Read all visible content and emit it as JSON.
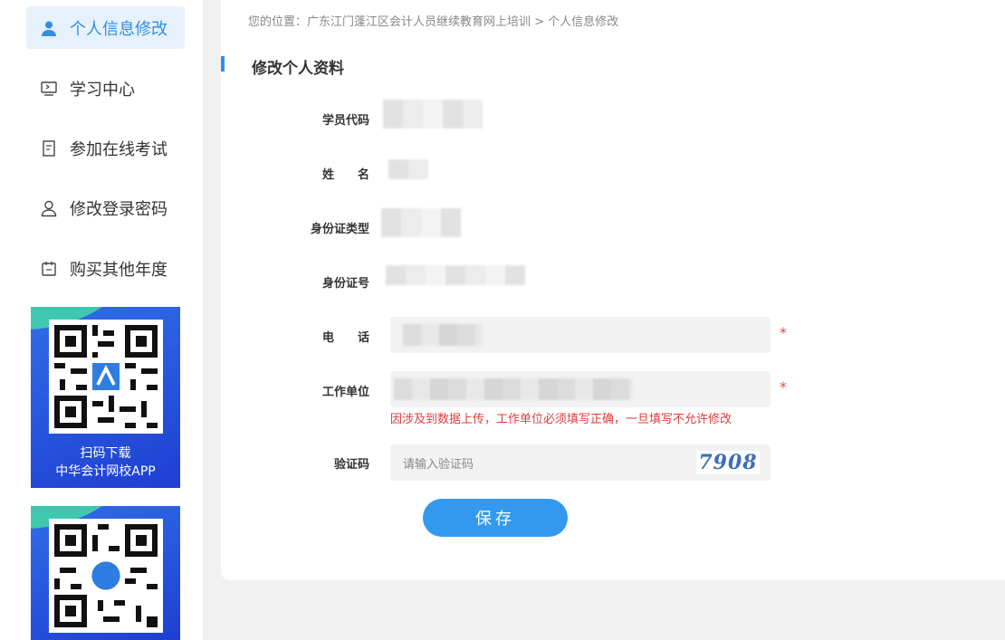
{
  "sidebar": {
    "items": [
      {
        "label": "个人信息修改",
        "icon": "user-icon",
        "active": true
      },
      {
        "label": "学习中心",
        "icon": "monitor-icon",
        "active": false
      },
      {
        "label": "参加在线考试",
        "icon": "exam-doc-icon",
        "active": false
      },
      {
        "label": "修改登录密码",
        "icon": "user-icon",
        "active": false
      },
      {
        "label": "购买其他年度",
        "icon": "calendar-icon",
        "active": false
      }
    ],
    "promos": [
      {
        "caption_line1": "扫码下载",
        "caption_line2": "中华会计网校APP"
      },
      {
        "caption_line1": "",
        "caption_line2": ""
      }
    ]
  },
  "breadcrumb": "您的位置：广东江门蓬江区会计人员继续教育网上培训 > 个人信息修改",
  "section_title": "修改个人资料",
  "form": {
    "student_code_label": "学员代码",
    "name_label": "姓　　名",
    "id_type_label": "身份证类型",
    "id_number_label": "身份证号",
    "phone_label": "电　　话",
    "work_unit_label": "工作单位",
    "work_unit_warning": "因涉及到数据上传，工作单位必须填写正确，一旦填写不允许修改",
    "captcha_label": "验证码",
    "captcha_placeholder": "请输入验证码",
    "captcha_code": "7908",
    "required_mark": "*",
    "save_label": "保存"
  },
  "colors": {
    "accent": "#2f8fe8",
    "button": "#3399ee",
    "warning": "#e03b3b",
    "promo_bg": "#2f6ee8"
  }
}
